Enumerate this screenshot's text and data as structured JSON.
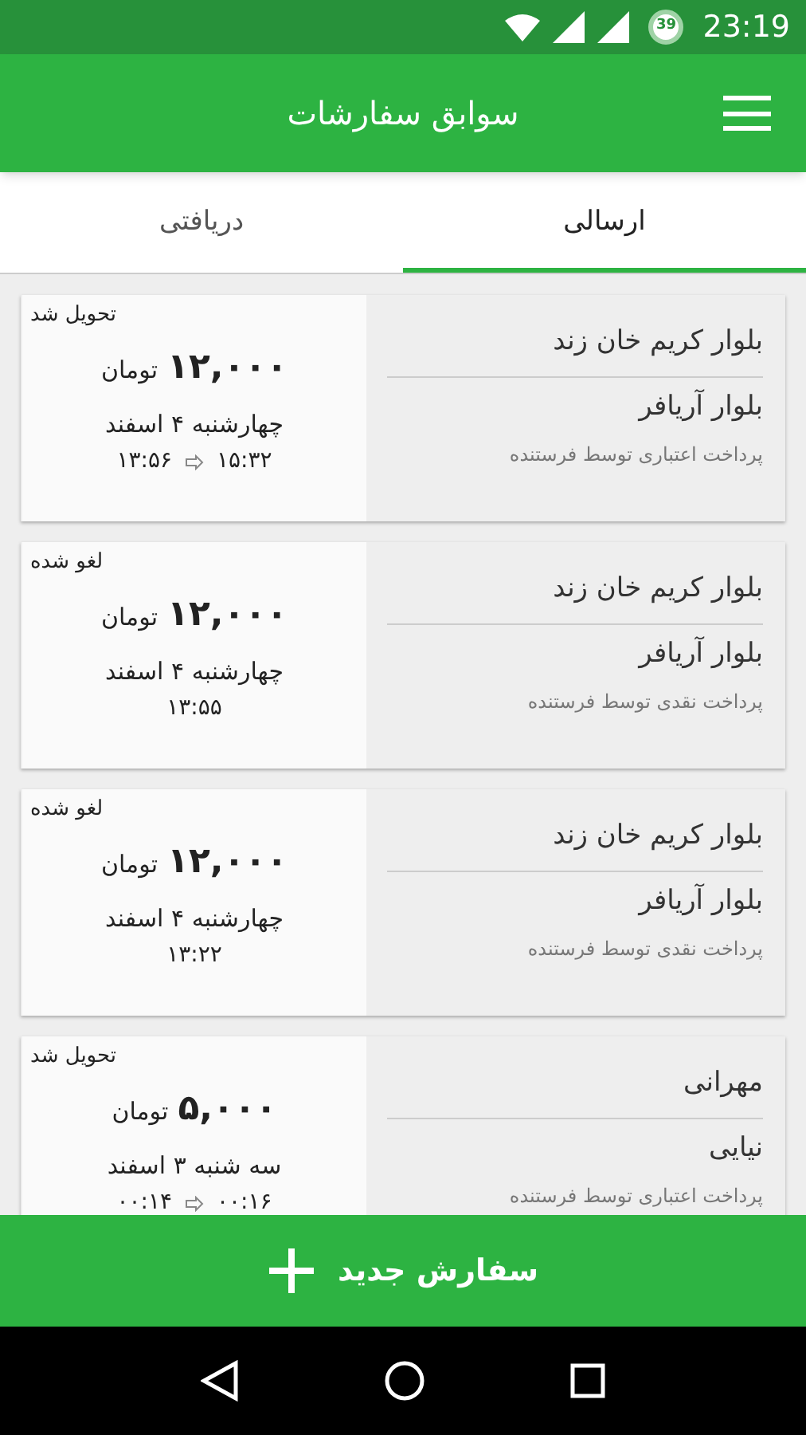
{
  "status_bar": {
    "battery": "39",
    "time": "23:19"
  },
  "app_bar": {
    "title": "سوابق سفارشات"
  },
  "tabs": [
    {
      "label": "ارسالی",
      "selected": true
    },
    {
      "label": "دریافتی",
      "selected": false
    }
  ],
  "orders": [
    {
      "origin": "بلوار کریم خان زند",
      "destination": "بلوار آریافر",
      "payment": "پرداخت اعتباری توسط فرستنده",
      "status": "تحویل شد",
      "amount": "۱۲,۰۰۰",
      "currency": "تومان",
      "date": "چهارشنبه ۴ اسفند",
      "start_time": "۱۳:۵۶",
      "end_time": "۱۵:۳۲"
    },
    {
      "origin": "بلوار کریم خان زند",
      "destination": "بلوار آریافر",
      "payment": "پرداخت نقدی توسط فرستنده",
      "status": "لغو شده",
      "amount": "۱۲,۰۰۰",
      "currency": "تومان",
      "date": "چهارشنبه ۴ اسفند",
      "start_time": "۱۳:۵۵"
    },
    {
      "origin": "بلوار کریم خان زند",
      "destination": "بلوار آریافر",
      "payment": "پرداخت نقدی توسط فرستنده",
      "status": "لغو شده",
      "amount": "۱۲,۰۰۰",
      "currency": "تومان",
      "date": "چهارشنبه ۴ اسفند",
      "start_time": "۱۳:۲۲"
    },
    {
      "origin": "مهرانی",
      "destination": "نیایی",
      "payment": "پرداخت اعتباری توسط فرستنده",
      "status": "تحویل شد",
      "amount": "۵,۰۰۰",
      "currency": "تومان",
      "date": "سه شنبه ۳ اسفند",
      "start_time": "۰۰:۱۴",
      "end_time": "۰۰:۱۶"
    }
  ],
  "new_order_button": {
    "label": "سفارش جدید"
  }
}
